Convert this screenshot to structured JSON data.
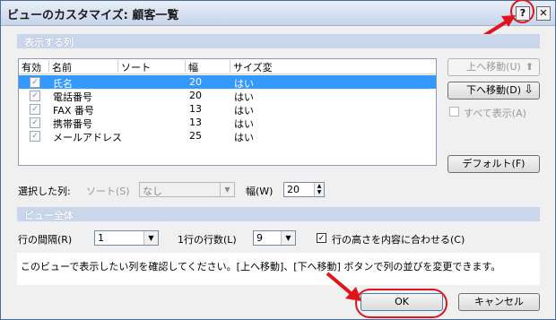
{
  "window": {
    "title": "ビューのカスタマイズ: 顧客一覧",
    "help_label": "?",
    "close_label": "✕"
  },
  "sections": {
    "columns": "表示する列",
    "view": "ビュー全体"
  },
  "list": {
    "headers": [
      "有効",
      "名前",
      "ソート",
      "幅",
      "サイズ変"
    ],
    "rows": [
      {
        "check": "✓",
        "name": "氏名",
        "sort": "",
        "width": "20",
        "resize": "はい",
        "selected": true
      },
      {
        "check": "✓",
        "name": "電話番号",
        "sort": "",
        "width": "20",
        "resize": "はい",
        "selected": false
      },
      {
        "check": "✓",
        "name": "FAX 番号",
        "sort": "",
        "width": "13",
        "resize": "はい",
        "selected": false
      },
      {
        "check": "✓",
        "name": "携帯番号",
        "sort": "",
        "width": "13",
        "resize": "はい",
        "selected": false
      },
      {
        "check": "✓",
        "name": "メールアドレス",
        "sort": "",
        "width": "25",
        "resize": "はい",
        "selected": false
      }
    ]
  },
  "side": {
    "move_up": "上へ移動(U)",
    "move_up_icon": "⬆",
    "move_down": "下へ移動(D)",
    "move_down_icon": "⇩",
    "show_all": "すべて表示(A)",
    "default": "デフォルト(F)"
  },
  "selected_column": {
    "label": "選択した列:",
    "sort_label": "ソート(S)",
    "sort_value": "なし",
    "width_label": "幅(W)",
    "width_value": "20"
  },
  "view": {
    "row_spacing_label": "行の間隔(R)",
    "row_spacing_value": "1",
    "lines_per_row_label": "1行の行数(L)",
    "lines_per_row_value": "9",
    "fit_height_label": "行の高さを内容に合わせる(C)",
    "fit_height_check": "✓"
  },
  "info": "このビューで表示したい列を確認してください。[上へ移動]、[下へ移動] ボタンで列の並びを変更できます。",
  "footer": {
    "ok": "OK",
    "cancel": "キャンセル"
  },
  "colors": {
    "highlight": "#e0141a",
    "selection": "#3399ff",
    "section": "#c9d6ec"
  }
}
